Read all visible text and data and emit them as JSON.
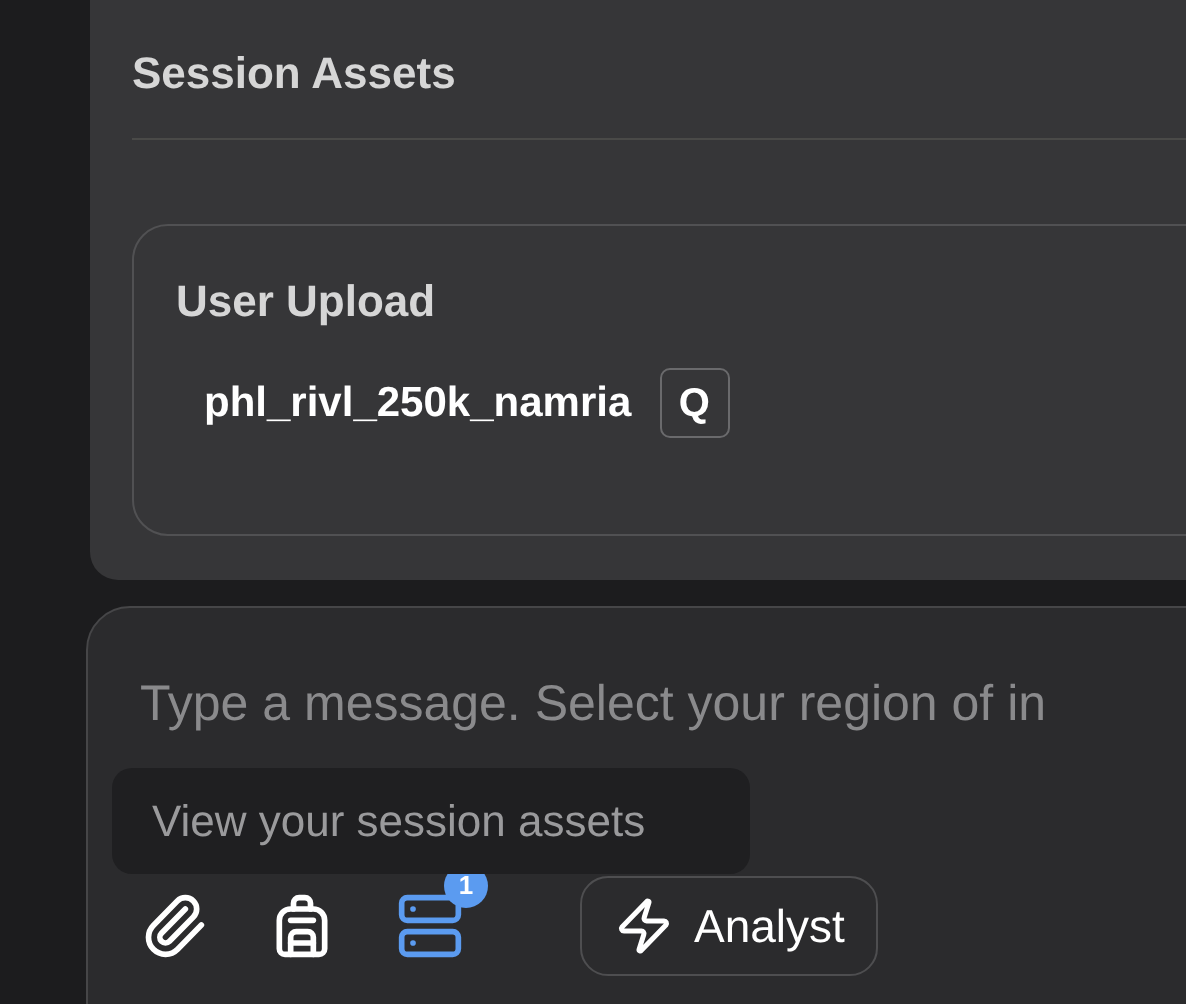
{
  "assets_panel": {
    "title": "Session Assets",
    "groups": [
      {
        "title": "User Upload",
        "items": [
          {
            "name": "phl_rivl_250k_namria",
            "tag": "Q"
          }
        ]
      }
    ]
  },
  "composer": {
    "placeholder": "Type a message. Select your region of in",
    "tooltip": "View your session assets",
    "tools": [
      {
        "kind": "attach",
        "selected": false
      },
      {
        "kind": "backpack",
        "selected": false
      },
      {
        "kind": "assets",
        "selected": true,
        "badge": "1"
      }
    ],
    "mode_button": "Analyst"
  }
}
